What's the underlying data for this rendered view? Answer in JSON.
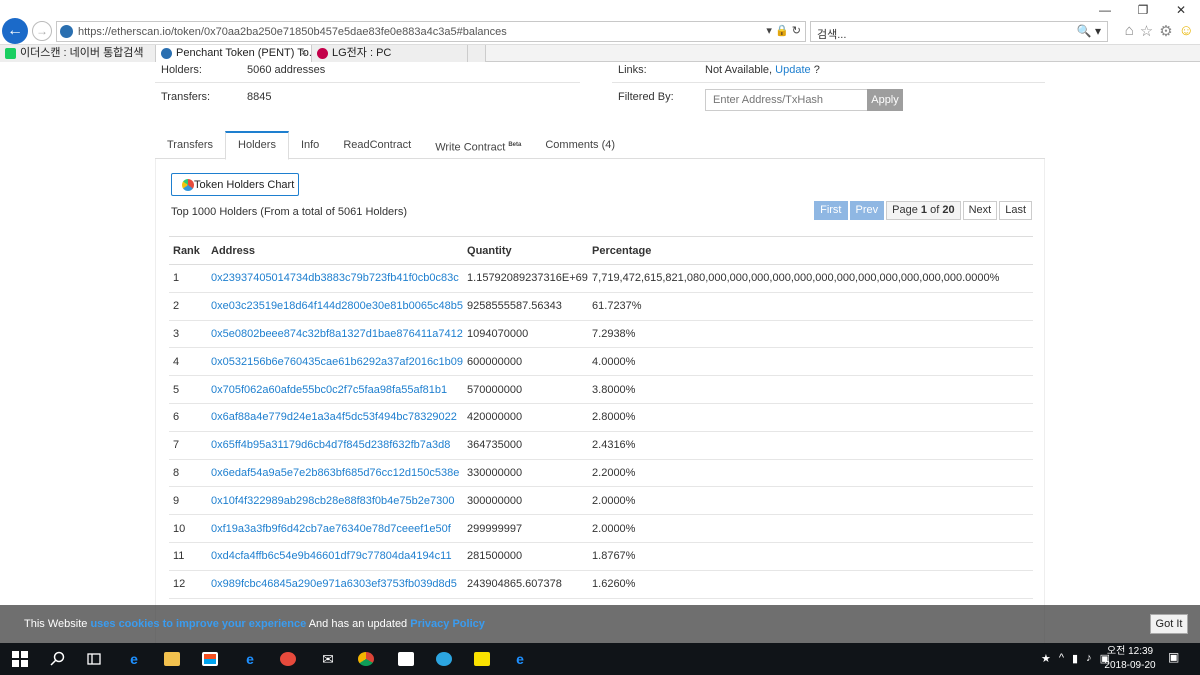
{
  "browser": {
    "url": "https://etherscan.io/token/0x70aa2ba250e71850b457e5dae83fe0e883a4c3a5#balances",
    "search_placeholder": "검색...",
    "tabs": [
      {
        "label": "이더스캔 : 네이버 통합검색"
      },
      {
        "label": "Penchant Token (PENT) To..."
      },
      {
        "label": "LG전자 : PC"
      }
    ]
  },
  "summary": {
    "holders_label": "Holders:",
    "holders_value": "5060 addresses",
    "transfers_label": "Transfers:",
    "transfers_value": "8845",
    "links_label": "Links:",
    "links_value": "Not Available,",
    "update_link": "Update",
    "links_suffix": "?",
    "filtered_label": "Filtered By:",
    "filter_placeholder": "Enter Address/TxHash",
    "apply_label": "Apply"
  },
  "tabs": [
    {
      "label": "Transfers",
      "active": false
    },
    {
      "label": "Holders",
      "active": true
    },
    {
      "label": "Info",
      "active": false
    },
    {
      "label": "ReadContract",
      "active": false
    },
    {
      "label": "Write Contract",
      "badge": "Beta",
      "active": false
    },
    {
      "label": "Comments (4)",
      "active": false
    }
  ],
  "holders": {
    "chart_button": "Token Holders Chart",
    "summary": "Top 1000 Holders (From a total of 5061 Holders)",
    "pager": {
      "first": "First",
      "prev": "Prev",
      "page_prefix": "Page",
      "page": "1",
      "of": "of",
      "total": "20",
      "next": "Next",
      "last": "Last"
    },
    "columns": [
      "Rank",
      "Address",
      "Quantity",
      "Percentage"
    ],
    "rows": [
      [
        "1",
        "0x23937405014734db3883c79b723fb41f0cb0c83c",
        "1.15792089237316E+69",
        "7,719,472,615,821,080,000,000,000,000,000,000,000,000,000,000,000,000.0000%"
      ],
      [
        "2",
        "0xe03c23519e18d64f144d2800e30e81b0065c48b5",
        "9258555587.56343",
        "61.7237%"
      ],
      [
        "3",
        "0x5e0802beee874c32bf8a1327d1bae876411a7412",
        "1094070000",
        "7.2938%"
      ],
      [
        "4",
        "0x0532156b6e760435cae61b6292a37af2016c1b09",
        "600000000",
        "4.0000%"
      ],
      [
        "5",
        "0x705f062a60afde55bc0c2f7c5faa98fa55af81b1",
        "570000000",
        "3.8000%"
      ],
      [
        "6",
        "0x6af88a4e779d24e1a3a4f5dc53f494bc78329022",
        "420000000",
        "2.8000%"
      ],
      [
        "7",
        "0x65ff4b95a31179d6cb4d7f845d238f632fb7a3d8",
        "364735000",
        "2.4316%"
      ],
      [
        "8",
        "0x6edaf54a9a5e7e2b863bf685d76cc12d150c538e",
        "330000000",
        "2.2000%"
      ],
      [
        "9",
        "0x10f4f322989ab298cb28e88f83f0b4e75b2e7300",
        "300000000",
        "2.0000%"
      ],
      [
        "10",
        "0xf19a3a3fb9f6d42cb7ae76340e78d7ceeef1e50f",
        "299999997",
        "2.0000%"
      ],
      [
        "11",
        "0xd4cfa4ffb6c54e9b46601df79c77804da4194c11",
        "281500000",
        "1.8767%"
      ],
      [
        "12",
        "0x989fcbc46845a290e971a6303ef3753fb039d8d5",
        "243904865.607378",
        "1.6260%"
      ]
    ]
  },
  "cookie": {
    "text1": "This Website",
    "link1": "uses cookies to improve your experience",
    "text2": "And has an updated",
    "link2": "Privacy Policy",
    "button": "Got It"
  },
  "taskbar": {
    "time": "오전 12:39",
    "date": "2018-09-20"
  }
}
